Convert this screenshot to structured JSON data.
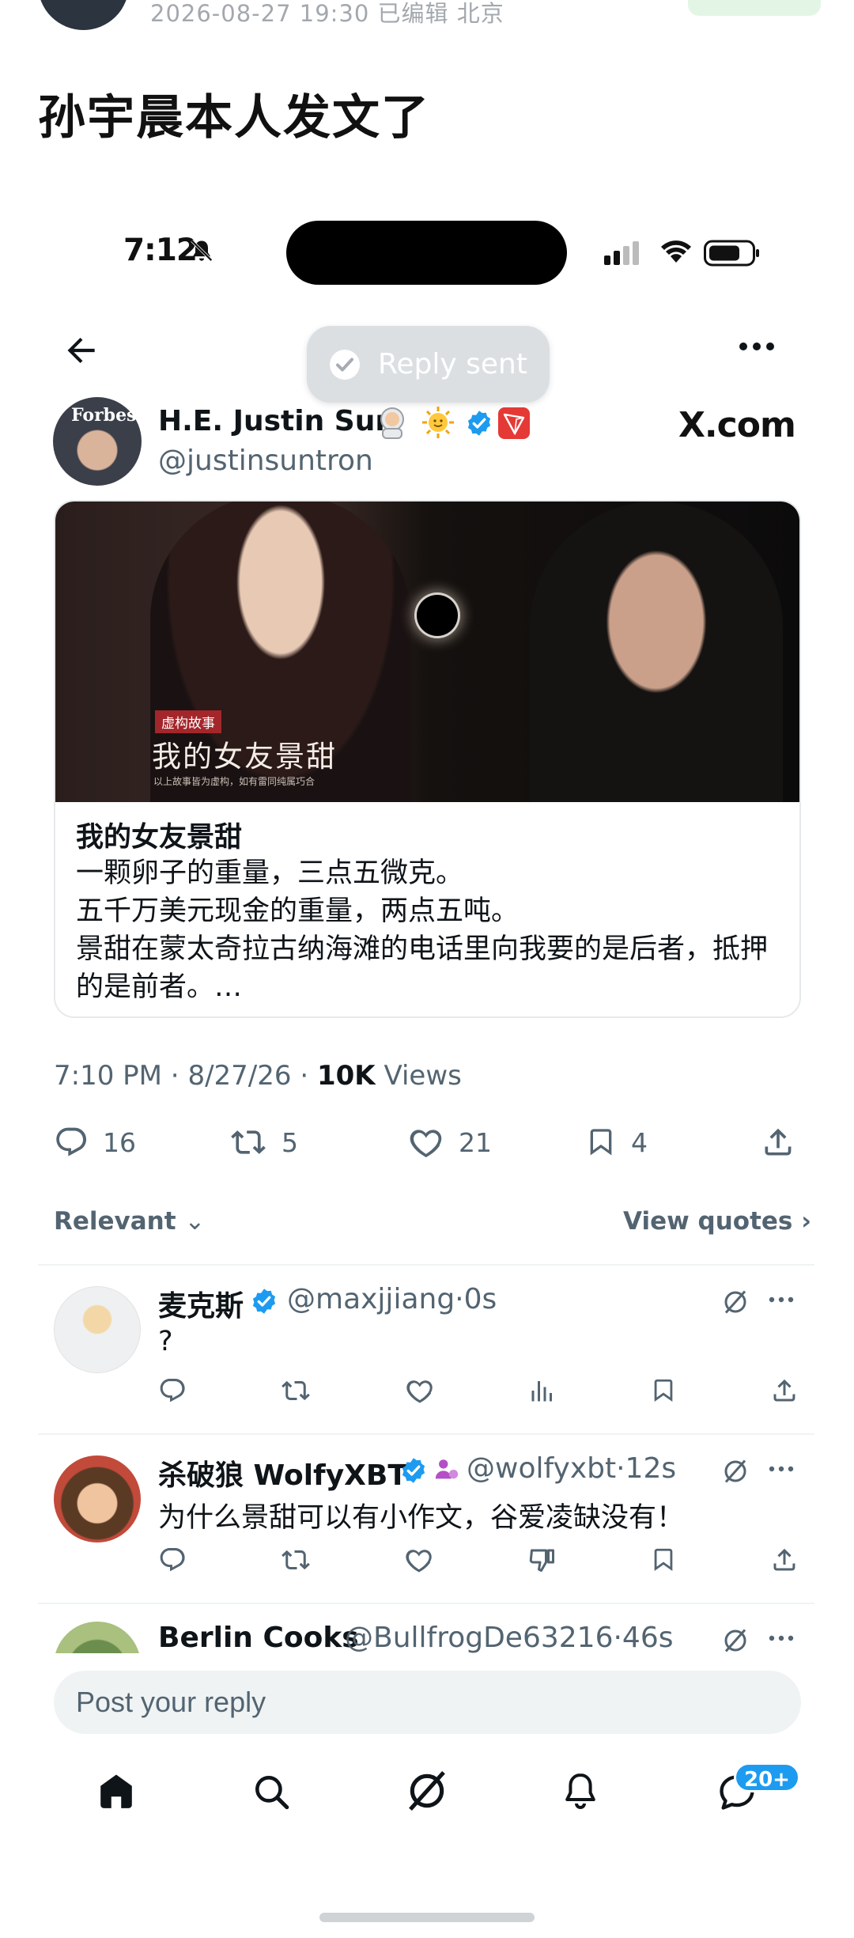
{
  "outer": {
    "meta": "2026-08-27 19:30  已编辑  北京",
    "title": "孙宇晨本人发文了"
  },
  "status_bar": {
    "time": "7:12"
  },
  "toast": {
    "label": "Reply sent"
  },
  "post": {
    "author_name": "H.E. Justin Sun",
    "author_handle": "@justinsuntron",
    "avatar_text": "Forbes",
    "source": "X.com",
    "card": {
      "image_tag": "虚构故事",
      "image_title": "我的女友景甜",
      "image_caption": "以上故事皆为虚构，如有雷同纯属巧合",
      "title": "我的女友景甜",
      "body": [
        "一颗卵子的重量，三点五微克。",
        "五千万美元现金的重量，两点五吨。",
        "景甜在蒙太奇拉古纳海滩的电话里向我要的是后者，抵押的是前者。…"
      ]
    },
    "time": "7:10 PM",
    "date": "8/27/26",
    "views_count": "10K",
    "views_label": "Views",
    "stats": {
      "replies": "16",
      "reposts": "5",
      "likes": "21",
      "bookmarks": "4"
    }
  },
  "sort": {
    "label": "Relevant",
    "view_quotes": "View quotes"
  },
  "replies": [
    {
      "name": "麦克斯",
      "handle": "@maxjjiang",
      "time": "0s",
      "text": "?"
    },
    {
      "name": "杀破狼 WolfyXBT",
      "handle": "@wolfyxbt",
      "time": "12s",
      "text": "为什么景甜可以有小作文，谷爱凌缺没有！"
    },
    {
      "name": "Berlin Cooks",
      "handle": "@BullfrogDe63216",
      "time": "46s",
      "text": ""
    }
  ],
  "reply_bar": {
    "placeholder": "Post your reply"
  },
  "nav": {
    "messages_badge": "20+"
  },
  "colors": {
    "accent": "#1d9bf0",
    "secondary_text": "#536471",
    "tron_red": "#e53935"
  },
  "icons": [
    "back-arrow-icon",
    "more-icon",
    "check-circle-icon",
    "verified-icon",
    "reply-icon",
    "retweet-icon",
    "heart-icon",
    "bookmark-icon",
    "share-icon",
    "grok-icon",
    "analytics-icon",
    "downvote-icon",
    "home-icon",
    "search-icon",
    "bell-icon",
    "messages-icon"
  ]
}
